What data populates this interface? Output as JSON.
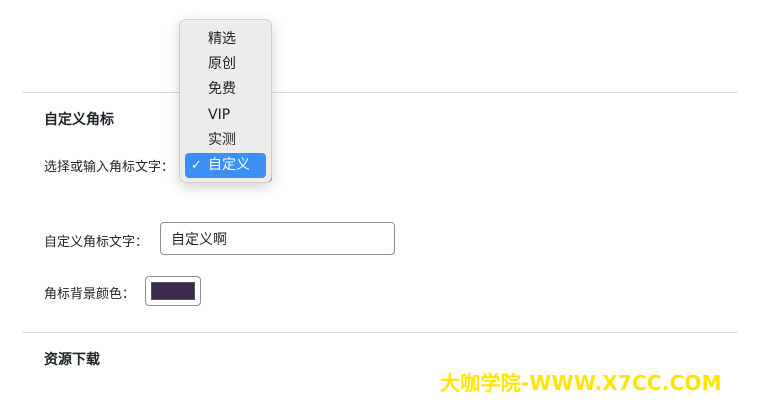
{
  "sections": [
    {
      "title": "自定义角标"
    },
    {
      "title": "资源下载"
    }
  ],
  "fields": {
    "badge_select_label": "选择或输入角标文字：",
    "badge_text_label": "自定义角标文字：",
    "badge_text_value": "自定义啊",
    "badge_bg_label": "角标背景颜色：",
    "badge_bg_color": "#3d2a4a"
  },
  "dropdown": {
    "items": [
      "精选",
      "原创",
      "免费",
      "VIP",
      "实测",
      "自定义"
    ],
    "selected": "自定义",
    "check_mark": "✓",
    "highlight_color": "#3b8ff5"
  },
  "watermark": {
    "text": "大咖学院-WWW.X7CC.COM",
    "color": "#ffe600"
  }
}
